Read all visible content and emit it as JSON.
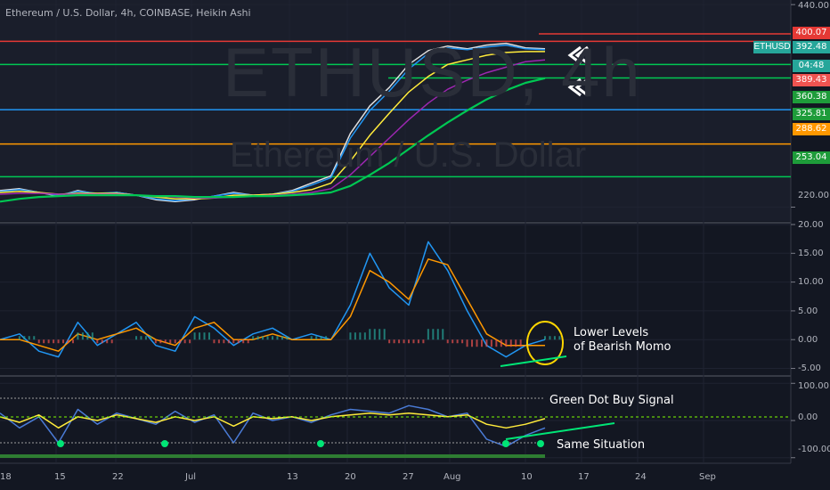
{
  "header": {
    "title": "Ethereum / U.S. Dollar, 4h, COINBASE, Heikin Ashi"
  },
  "watermark": {
    "symbol": "ETHUSD, 4h",
    "name": "Ethereum / U.S. Dollar"
  },
  "symbol_tag": "ETHUSD",
  "price_tags": [
    {
      "text": "400.07",
      "color": "#e53935"
    },
    {
      "text": "392.48",
      "color": "#26a69a"
    },
    {
      "text": "04:48",
      "color": "#26a69a"
    },
    {
      "text": "389.43",
      "color": "#ef5350"
    },
    {
      "text": "360.38",
      "color": "#1e9c3a"
    },
    {
      "text": "325.81",
      "color": "#1e9c3a"
    },
    {
      "text": "288.62",
      "color": "#ff9800"
    },
    {
      "text": "253.04",
      "color": "#1e9c3a"
    }
  ],
  "annotations": {
    "momo_line1": "Lower Levels",
    "momo_line2": "of Bearish Momo",
    "green_dot": "Green Dot Buy Signal",
    "same": "Same Situation"
  },
  "chart_data": [
    {
      "type": "line",
      "title": "Ethereum / U.S. Dollar, 4h, COINBASE, Heikin Ashi",
      "yticks": [
        "440.00",
        "220.00"
      ],
      "ylim": [
        205,
        445
      ],
      "x_labels": [
        "18",
        "15",
        "22",
        "Jul",
        "13",
        "20",
        "27",
        "Aug",
        "10",
        "17",
        "24",
        "Sep"
      ],
      "horizontal_levels": [
        {
          "value": 400.07,
          "color": "#e53935"
        },
        {
          "value": 375,
          "color": "#00c853"
        },
        {
          "value": 360.38,
          "color": "#00c853"
        },
        {
          "value": 325.81,
          "color": "#2196f3"
        },
        {
          "value": 288.62,
          "color": "#ff9800"
        },
        {
          "value": 253.04,
          "color": "#00c853"
        }
      ],
      "series": [
        {
          "color": "#e0e0e0",
          "values": [
            238,
            240,
            236,
            232,
            238,
            234,
            236,
            233,
            228,
            226,
            228,
            232,
            236,
            233,
            234,
            238,
            246,
            254,
            300,
            330,
            350,
            375,
            390,
            395,
            392,
            396,
            398,
            393,
            392
          ]
        },
        {
          "color": "#2196f3",
          "values": [
            237,
            239,
            236,
            233,
            237,
            235,
            236,
            233,
            229,
            227,
            229,
            232,
            235,
            233,
            234,
            237,
            244,
            252,
            295,
            325,
            346,
            370,
            387,
            393,
            391,
            394,
            396,
            392,
            391
          ]
        },
        {
          "color": "#ffeb3b",
          "values": [
            236,
            237,
            236,
            234,
            235,
            235,
            235,
            233,
            231,
            229,
            229,
            230,
            233,
            233,
            234,
            236,
            239,
            246,
            270,
            298,
            322,
            345,
            362,
            375,
            380,
            385,
            388,
            389,
            389
          ]
        },
        {
          "color": "#9c27b0",
          "values": [
            234,
            235,
            235,
            234,
            234,
            234,
            234,
            233,
            232,
            231,
            230,
            230,
            231,
            232,
            233,
            234,
            236,
            240,
            255,
            275,
            295,
            315,
            333,
            348,
            358,
            366,
            372,
            378,
            380
          ]
        },
        {
          "color": "#00c853",
          "values": [
            226,
            229,
            231,
            232,
            233,
            233,
            233,
            233,
            232,
            232,
            231,
            231,
            231,
            232,
            232,
            233,
            234,
            236,
            243,
            255,
            268,
            283,
            298,
            312,
            325,
            337,
            347,
            355,
            360
          ]
        }
      ]
    },
    {
      "type": "line",
      "yticks": [
        "20.00",
        "15.00",
        "10.00",
        "5.00",
        "0.00",
        "-5.00"
      ],
      "ylim": [
        -6,
        20
      ],
      "series": [
        {
          "color": "#2196f3",
          "values": [
            0,
            1,
            -2,
            -3,
            3,
            -1,
            1,
            3,
            -1,
            -2,
            4,
            2,
            -1,
            1,
            2,
            0,
            1,
            0,
            6,
            15,
            9,
            6,
            17,
            12,
            5,
            -1,
            -3,
            -1,
            0
          ]
        },
        {
          "color": "#ff9800",
          "values": [
            0,
            0,
            -1,
            -2,
            1,
            0,
            1,
            2,
            0,
            -1,
            2,
            3,
            0,
            0,
            1,
            0,
            0,
            0,
            4,
            12,
            10,
            7,
            14,
            13,
            7,
            1,
            -1,
            -1,
            -1
          ]
        }
      ]
    },
    {
      "type": "line",
      "yticks": [
        "100.00",
        "0.00",
        "-100.00"
      ],
      "ylim": [
        -115,
        115
      ],
      "series": [
        {
          "color": "#4a7bd6",
          "values": [
            20,
            -20,
            10,
            -60,
            30,
            -10,
            20,
            5,
            -10,
            25,
            -5,
            15,
            -60,
            20,
            0,
            10,
            -5,
            15,
            30,
            25,
            20,
            40,
            30,
            10,
            20,
            -50,
            -70,
            -40,
            -20
          ]
        },
        {
          "color": "#ffeb3b",
          "values": [
            10,
            -5,
            15,
            -20,
            10,
            0,
            15,
            5,
            -5,
            10,
            0,
            10,
            -15,
            10,
            5,
            10,
            0,
            10,
            15,
            20,
            15,
            20,
            15,
            10,
            15,
            -10,
            -20,
            -10,
            5
          ]
        }
      ]
    }
  ]
}
